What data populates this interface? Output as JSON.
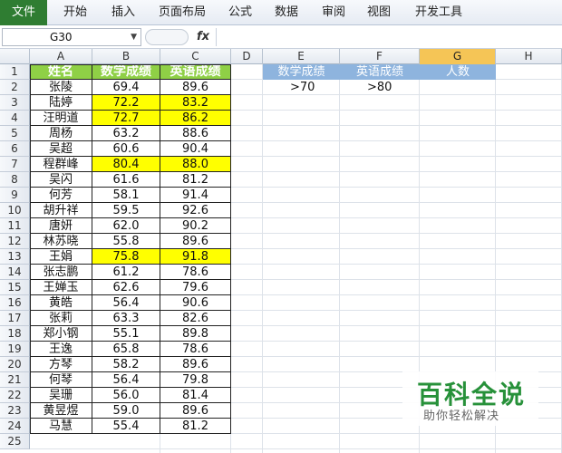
{
  "ribbon": {
    "tabs": [
      "文件",
      "开始",
      "插入",
      "页面布局",
      "公式",
      "数据",
      "审阅",
      "视图",
      "开发工具"
    ]
  },
  "formula_bar": {
    "name_box": "G30",
    "fx_label": "fx",
    "formula": ""
  },
  "columns": [
    "A",
    "B",
    "C",
    "D",
    "E",
    "F",
    "G",
    "H"
  ],
  "selected_column": "G",
  "rows": [
    "1",
    "2",
    "3",
    "4",
    "5",
    "6",
    "7",
    "8",
    "9",
    "10",
    "11",
    "12",
    "13",
    "14",
    "15",
    "16",
    "17",
    "18",
    "19",
    "20",
    "21",
    "22",
    "23",
    "24",
    "25"
  ],
  "table": {
    "headers": [
      "姓名",
      "数学成绩",
      "英语成绩"
    ],
    "header_color": "#8fd046",
    "highlight_color": "#ffff00",
    "records": [
      {
        "name": "张陵",
        "math": "69.4",
        "english": "89.6",
        "highlight": false
      },
      {
        "name": "陆婷",
        "math": "72.2",
        "english": "83.2",
        "highlight": true
      },
      {
        "name": "汪明道",
        "math": "72.7",
        "english": "86.2",
        "highlight": true
      },
      {
        "name": "周杨",
        "math": "63.2",
        "english": "88.6",
        "highlight": false
      },
      {
        "name": "吴超",
        "math": "60.6",
        "english": "90.4",
        "highlight": false
      },
      {
        "name": "程群峰",
        "math": "80.4",
        "english": "88.0",
        "highlight": true
      },
      {
        "name": "吴闪",
        "math": "61.6",
        "english": "81.2",
        "highlight": false
      },
      {
        "name": "何芳",
        "math": "58.1",
        "english": "91.4",
        "highlight": false
      },
      {
        "name": "胡升祥",
        "math": "59.5",
        "english": "92.6",
        "highlight": false
      },
      {
        "name": "唐妍",
        "math": "62.0",
        "english": "90.2",
        "highlight": false
      },
      {
        "name": "林苏晓",
        "math": "55.8",
        "english": "89.6",
        "highlight": false
      },
      {
        "name": "王娟",
        "math": "75.8",
        "english": "91.8",
        "highlight": true
      },
      {
        "name": "张志鹏",
        "math": "61.2",
        "english": "78.6",
        "highlight": false
      },
      {
        "name": "王婵玉",
        "math": "62.6",
        "english": "79.6",
        "highlight": false
      },
      {
        "name": "黄皓",
        "math": "56.4",
        "english": "90.6",
        "highlight": false
      },
      {
        "name": "张莉",
        "math": "63.3",
        "english": "82.6",
        "highlight": false
      },
      {
        "name": "郑小钢",
        "math": "55.1",
        "english": "89.8",
        "highlight": false
      },
      {
        "name": "王逸",
        "math": "65.8",
        "english": "78.6",
        "highlight": false
      },
      {
        "name": "方琴",
        "math": "58.2",
        "english": "89.6",
        "highlight": false
      },
      {
        "name": "何琴",
        "math": "56.4",
        "english": "79.8",
        "highlight": false
      },
      {
        "name": "吴珊",
        "math": "56.0",
        "english": "81.4",
        "highlight": false
      },
      {
        "name": "黄昱煜",
        "math": "59.0",
        "english": "89.6",
        "highlight": false
      },
      {
        "name": "马慧",
        "math": "55.4",
        "english": "81.2",
        "highlight": false
      }
    ]
  },
  "criteria": {
    "headers": [
      "数学成绩",
      "英语成绩",
      "人数"
    ],
    "header_color": "#8eb4de",
    "values": [
      ">70",
      ">80",
      ""
    ]
  },
  "watermark": {
    "title": "百科全说",
    "subtitle": "助你轻松解决"
  }
}
